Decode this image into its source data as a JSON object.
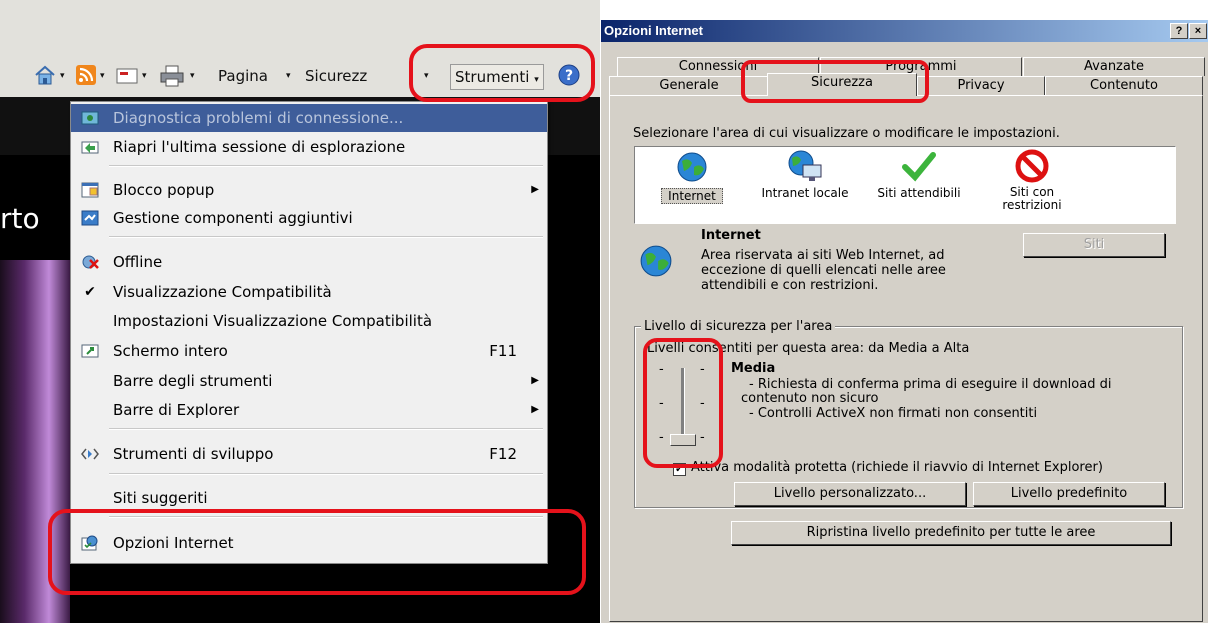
{
  "left_window": {
    "command_bar": {
      "pagina": "Pagina",
      "sicurezza": "Sicurezz",
      "strumenti": "Strumenti",
      "arrow": "▾"
    },
    "background_text": "rto",
    "tools_menu": {
      "items": [
        {
          "label": "Diagnostica problemi di connessione...",
          "icon": "network-diagnostic-icon"
        },
        {
          "label": "Riapri l'ultima sessione di esplorazione",
          "icon": "reopen-session-icon"
        },
        {
          "label": "Blocco popup",
          "icon": "popup-blocker-icon"
        },
        {
          "label": "Gestione componenti aggiuntivi",
          "icon": "addons-icon"
        },
        {
          "label": "Offline",
          "icon": "offline-icon"
        },
        {
          "label": "Visualizzazione Compatibilità",
          "icon": "checkmark-icon"
        },
        {
          "label": "Impostazioni Visualizzazione Compatibilità"
        },
        {
          "label": "Schermo intero",
          "icon": "fullscreen-icon",
          "shortcut": "F11"
        },
        {
          "label": "Barre degli strumenti"
        },
        {
          "label": "Barre di Explorer"
        },
        {
          "label": "Strumenti di sviluppo",
          "icon": "developer-tools-icon",
          "shortcut": "F12"
        },
        {
          "label": "Siti suggeriti"
        },
        {
          "label": "Opzioni Internet",
          "icon": "internet-options-icon"
        }
      ]
    }
  },
  "dialog": {
    "title": "Opzioni Internet",
    "title_buttons": {
      "help": "?",
      "close": "×"
    },
    "tabs_row1": [
      "Connessioni",
      "Programmi",
      "Avanzate"
    ],
    "tabs_row2": [
      "Generale",
      "Sicurezza",
      "Privacy",
      "Contenuto"
    ],
    "active_tab": "Sicurezza",
    "instruction": "Selezionare l'area di cui visualizzare o modificare le impostazioni.",
    "zones": [
      {
        "label": "Internet",
        "icon": "globe-icon"
      },
      {
        "label": "Intranet locale",
        "icon": "intranet-icon"
      },
      {
        "label": "Siti attendibili",
        "icon": "checkmark-icon"
      },
      {
        "label": "Siti con restrizioni",
        "icon": "restricted-icon"
      }
    ],
    "zone_info": {
      "title": "Internet",
      "line1": "Area riservata ai siti Web Internet, ad",
      "line2": "eccezione di quelli elencati nelle aree",
      "line3": "attendibili e con restrizioni."
    },
    "sites_button": "Siti",
    "security_group": {
      "label": "Livello di sicurezza per l'area",
      "allowed_levels": "Livelli consentiti per questa area: da Media a Alta",
      "level_name": "Media",
      "bullet1a": "- Richiesta di conferma prima di eseguire il download di",
      "bullet1b": "contenuto non sicuro",
      "bullet2": "- Controlli ActiveX non firmati non consentiti"
    },
    "protected_mode": {
      "checked": true,
      "label": "Attiva modalità protetta (richiede il riavvio di Internet Explorer)"
    },
    "custom_level_button": "Livello personalizzato...",
    "default_level_button": "Livello predefinito",
    "reset_all_button": "Ripristina livello predefinito per tutte le aree"
  }
}
